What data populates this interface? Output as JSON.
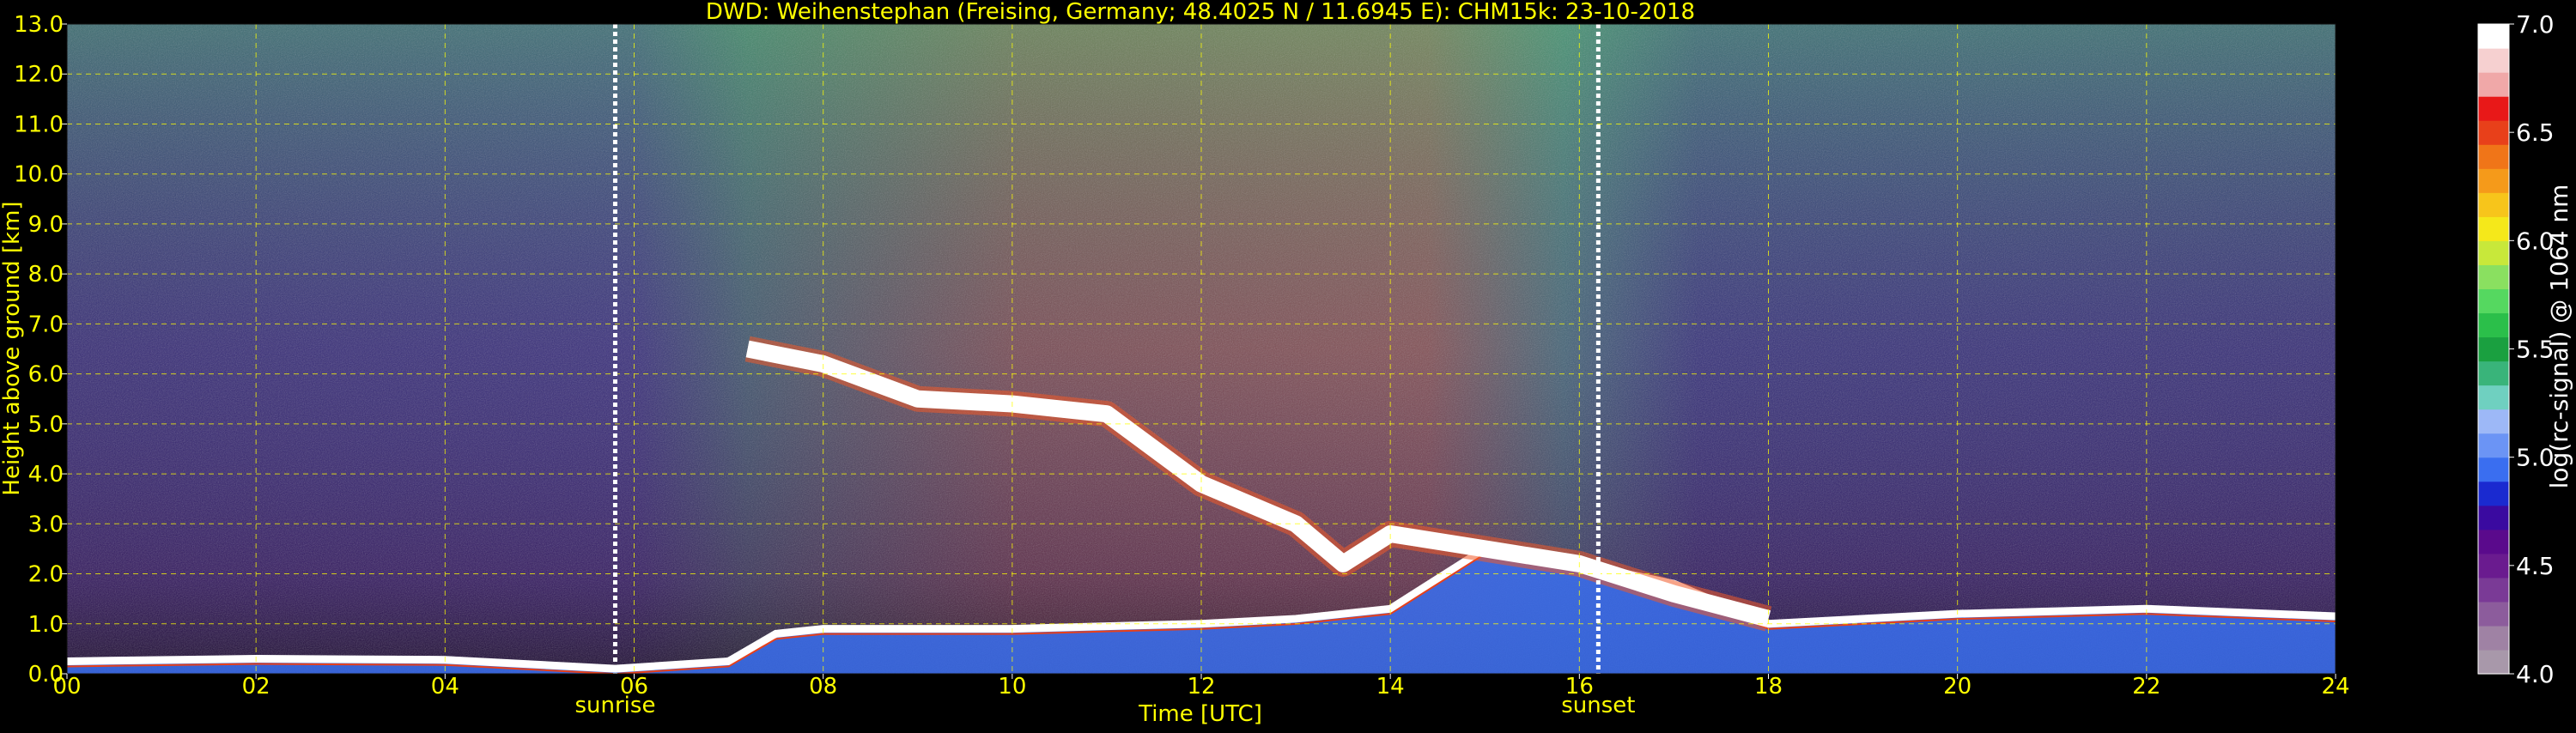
{
  "chart_data": {
    "type": "heatmap",
    "title": "DWD: Weihenstephan (Freising, Germany; 48.4025 N / 11.6945 E):    CHM15k: 23-10-2018",
    "xlabel": "Time [UTC]",
    "ylabel": "Height above ground [km]",
    "xlim": [
      0,
      24
    ],
    "ylim": [
      0,
      13
    ],
    "x_ticks": [
      "00",
      "02",
      "04",
      "06",
      "08",
      "10",
      "12",
      "14",
      "16",
      "18",
      "20",
      "22",
      "24"
    ],
    "y_ticks": [
      "0.0",
      "1.0",
      "2.0",
      "3.0",
      "4.0",
      "5.0",
      "6.0",
      "7.0",
      "8.0",
      "9.0",
      "10.0",
      "11.0",
      "12.0",
      "13.0"
    ],
    "grid": true,
    "annotations": [
      {
        "label": "sunrise",
        "time": 5.8
      },
      {
        "label": "sunset",
        "time": 16.2
      }
    ],
    "colorbar": {
      "label": "log(rc-signal) @ 1064 nm",
      "range": [
        4.0,
        7.0
      ],
      "ticks": [
        "4.0",
        "4.5",
        "5.0",
        "5.5",
        "6.0",
        "6.5",
        "7.0"
      ],
      "colors": [
        "#a898aa",
        "#9f82a4",
        "#8c5c9c",
        "#7a3a96",
        "#6a1b8f",
        "#5a0a8c",
        "#3a0aa0",
        "#1a2ad0",
        "#3a6ef0",
        "#6b94f5",
        "#9db8f7",
        "#6fd0c0",
        "#39b47a",
        "#1aa040",
        "#2bbf4a",
        "#55d860",
        "#8ae060",
        "#c8e83a",
        "#f5e81a",
        "#f7c51b",
        "#f59a1a",
        "#f07518",
        "#e8401a",
        "#e81818",
        "#f0a8a8",
        "#f6d0d0",
        "#ffffff"
      ]
    },
    "features": {
      "boundary_layer_top_km": [
        [
          0,
          0.25
        ],
        [
          2,
          0.3
        ],
        [
          4,
          0.28
        ],
        [
          5.8,
          0.1
        ],
        [
          7,
          0.25
        ],
        [
          7.5,
          0.8
        ],
        [
          8,
          0.9
        ],
        [
          10,
          0.9
        ],
        [
          11,
          0.95
        ],
        [
          12,
          1.0
        ],
        [
          13,
          1.1
        ],
        [
          14,
          1.3
        ],
        [
          15,
          2.5
        ],
        [
          16,
          2.2
        ],
        [
          17,
          1.8
        ],
        [
          18,
          1.0
        ],
        [
          20,
          1.2
        ],
        [
          22,
          1.3
        ],
        [
          24,
          1.15
        ]
      ],
      "cloud_layer_km": [
        [
          7.2,
          6.5
        ],
        [
          8,
          6.2
        ],
        [
          9,
          5.5
        ],
        [
          10,
          5.4
        ],
        [
          11,
          5.2
        ],
        [
          12,
          3.8
        ],
        [
          13,
          3.0
        ],
        [
          13.5,
          2.2
        ],
        [
          14,
          2.8
        ],
        [
          15,
          2.5
        ],
        [
          16,
          2.2
        ],
        [
          17,
          1.6
        ],
        [
          18,
          1.1
        ]
      ]
    }
  }
}
